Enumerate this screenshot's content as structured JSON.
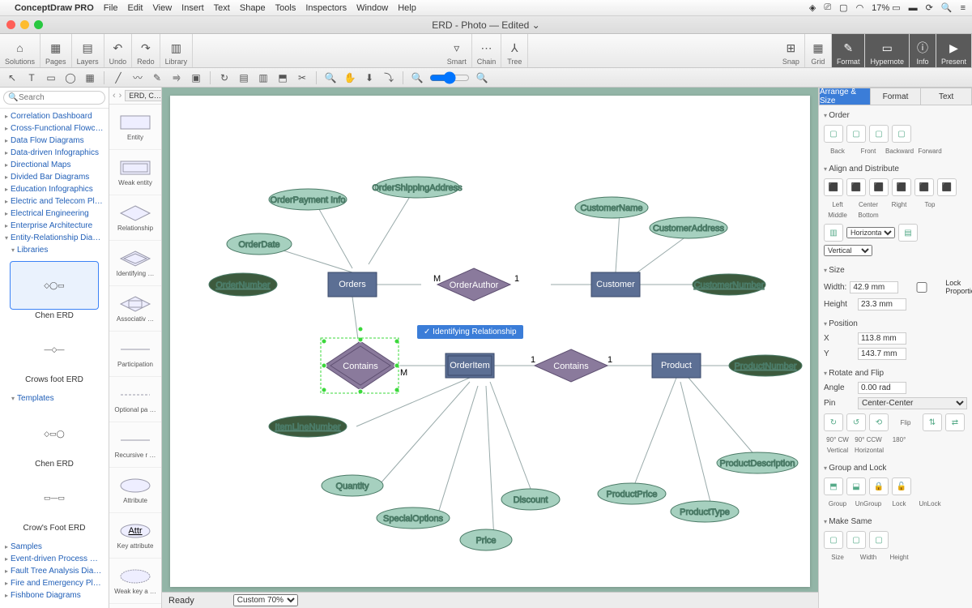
{
  "menubar": {
    "app": "ConceptDraw PRO",
    "items": [
      "File",
      "Edit",
      "View",
      "Insert",
      "Text",
      "Shape",
      "Tools",
      "Inspectors",
      "Window",
      "Help"
    ],
    "battery": "17%"
  },
  "window": {
    "title": "ERD - Photo — Edited ⌄"
  },
  "toolbar": {
    "groups": [
      {
        "label": "Solutions",
        "icons": [
          "⌂"
        ]
      },
      {
        "label": "Pages",
        "icons": [
          "▦"
        ]
      },
      {
        "label": "Layers",
        "icons": [
          "▤"
        ]
      },
      {
        "label": "Undo",
        "icons": [
          "↶"
        ]
      },
      {
        "label": "Redo",
        "icons": [
          "↷"
        ]
      },
      {
        "label": "Library",
        "icons": [
          "▥"
        ]
      }
    ],
    "center": [
      {
        "label": "Smart",
        "icons": [
          "▿"
        ]
      },
      {
        "label": "Chain",
        "icons": [
          "⋯"
        ]
      },
      {
        "label": "Tree",
        "icons": [
          "⅄"
        ]
      }
    ],
    "right": [
      {
        "label": "Snap",
        "icons": [
          "⊞"
        ]
      },
      {
        "label": "Grid",
        "icons": [
          "▦"
        ]
      },
      {
        "label": "Format",
        "icons": [
          "✎"
        ]
      },
      {
        "label": "Hypernote",
        "icons": [
          "▭"
        ]
      },
      {
        "label": "Info",
        "icons": [
          "ⓘ"
        ]
      },
      {
        "label": "Present",
        "icons": [
          "▶"
        ]
      }
    ]
  },
  "left_tree": {
    "search_placeholder": "Search",
    "items": [
      "Correlation Dashboard",
      "Cross-Functional Flowcharts",
      "Data Flow Diagrams",
      "Data-driven Infographics",
      "Directional Maps",
      "Divided Bar Diagrams",
      "Education Infographics",
      "Electric and Telecom Plans",
      "Electrical Engineering",
      "Enterprise Architecture"
    ],
    "open_item": "Entity-Relationship Diagram",
    "sub_items": [
      "Libraries"
    ],
    "templates_header": "Templates",
    "thumbs": [
      {
        "label": "Chen ERD",
        "selected": true
      },
      {
        "label": "Crows foot ERD",
        "selected": false
      }
    ],
    "template_thumbs": [
      {
        "label": "Chen ERD"
      },
      {
        "label": "Crow's Foot ERD"
      }
    ],
    "after_items": [
      "Samples",
      "Event-driven Process Chain",
      "Fault Tree Analysis Diagrams",
      "Fire and Emergency Plans",
      "Fishbone Diagrams"
    ]
  },
  "lib_panel": {
    "dropdown": "ERD, C…",
    "items": [
      {
        "label": "Entity",
        "shape": "rect"
      },
      {
        "label": "Weak entity",
        "shape": "rect2"
      },
      {
        "label": "Relationship",
        "shape": "diamond"
      },
      {
        "label": "Identifying …",
        "shape": "diamond2"
      },
      {
        "label": "Associativ …",
        "shape": "assoc"
      },
      {
        "label": "Participation",
        "shape": "line"
      },
      {
        "label": "Optional pa …",
        "shape": "dash"
      },
      {
        "label": "Recursive r …",
        "shape": "line"
      },
      {
        "label": "Attribute",
        "shape": "ellipse"
      },
      {
        "label": "Key attribute",
        "shape": "ellipseU"
      },
      {
        "label": "Weak key a …",
        "shape": "ellipseD"
      }
    ]
  },
  "canvas": {
    "tooltip": "Identifying Relationship",
    "entities": {
      "orders": "Orders",
      "customer": "Customer",
      "product": "Product",
      "orderitem": "OrderItem"
    },
    "relationships": {
      "orderauthor": "OrderAuthor",
      "contains1": "Contains",
      "contains2": "Contains"
    },
    "attributes": {
      "ordernumber": "OrderNumber",
      "orderdate": "OrderDate",
      "orderpayment": "OrderPayment Info",
      "ordershipping": "OrderShippingAddress",
      "customername": "CustomerName",
      "customeraddress": "CustomerAddress",
      "customernumber": "CustomerNumber",
      "productnumber": "ProductNumber",
      "productdesc": "ProductDescription",
      "productprice": "ProductPrice",
      "producttype": "ProductType",
      "itemline": "ItemLineNumber",
      "quantity": "Quantity",
      "specialoptions": "SpecialOptions",
      "price": "Price",
      "discount": "Discount"
    },
    "cardinality": {
      "m": "M",
      "one": "1"
    }
  },
  "inspector": {
    "tabs": [
      "Arrange & Size",
      "Format",
      "Text"
    ],
    "active_tab": 0,
    "sections": {
      "order": "Order",
      "order_btns": [
        "Back",
        "Front",
        "Backward",
        "Forward"
      ],
      "align": "Align and Distribute",
      "align_btns": [
        "Left",
        "Center",
        "Right",
        "Top",
        "Middle",
        "Bottom"
      ],
      "dist_h": "Horizontal",
      "dist_v": "Vertical",
      "size": "Size",
      "width_label": "Width:",
      "width_val": "42.9 mm",
      "height_label": "Height",
      "height_val": "23.3 mm",
      "lock": "Lock Proportions",
      "position": "Position",
      "x_label": "X",
      "x_val": "113.8 mm",
      "y_label": "Y",
      "y_val": "143.7 mm",
      "rotate": "Rotate and Flip",
      "angle_label": "Angle",
      "angle_val": "0.00 rad",
      "pin_label": "Pin",
      "pin_val": "Center-Center",
      "rot_btns": [
        "90° CW",
        "90° CCW",
        "180°",
        "Flip",
        "Vertical",
        "Horizontal"
      ],
      "group": "Group and Lock",
      "group_btns": [
        "Group",
        "UnGroup",
        "Lock",
        "UnLock"
      ],
      "makesame": "Make Same",
      "same_btns": [
        "Size",
        "Width",
        "Height"
      ]
    }
  },
  "status": {
    "zoom": "Custom 70%",
    "ready": "Ready"
  }
}
